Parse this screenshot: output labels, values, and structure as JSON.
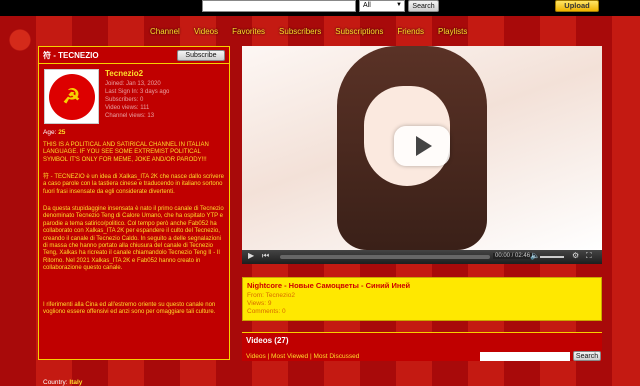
{
  "header": {
    "search_placeholder": "",
    "search_category": "All",
    "search_button": "Search",
    "upload_button": "Upload"
  },
  "nav": [
    "Channel",
    "Videos",
    "Favorites",
    "Subscribers",
    "Subscriptions",
    "Friends",
    "Playlists"
  ],
  "profile": {
    "title": "符 - TECNEZIO",
    "subscribe_label": "Subscribe",
    "username": "Tecnezio2",
    "info_lines": [
      "Joined: Jan 13, 2020",
      "Last Sign In: 3 days ago",
      "Subscribers: 0",
      "Video views: 111",
      "Channel views: 13"
    ],
    "age_label": "Age:",
    "age_value": "25",
    "paragraph_1": "THIS IS A POLITICAL AND SATIRICAL CHANNEL IN ITALIAN LANGUAGE. IF YOU SEE SOME EXTREMIST POLITICAL SYMBOL IT'S ONLY FOR MEME, JOKE AND/OR PARODY!!!",
    "paragraph_2": "符 - TECNEZIO è un idea di Xalkas_ITA 2K che nasce dallo scrivere a caso parole con la tastiera cinese e traducendo in italiano sortono fuori frasi insensate da egli considerate divertenti.",
    "paragraph_3": "Da questa stupidaggine insensata è nato il primo canale di Tecnezio denominato Tecnezio Teng di Calore Umano, che ha ospitato YTP e parodie a tema satirico/politico. Col tempo però anche Fab052 ha collaborato con Xalkas_ITA 2K per espandere il culto del Tecnezio, creando il canale di Tecnezio Caldo. In seguito a delle segnalazioni di massa che hanno portato alla chiusura del canale di Tecnezio Teng, Xalkas ha ricreato il canale chiamandolo Tecnezio Teng II - Il Ritorno. Nel 2021 Xalkas_ITA 2K e Fab052 hanno creato in collaborazione questo canale.",
    "paragraph_4": "I riferimenti alla Cina ed all'estremo oriente su questo canale non vogliono essere offensivi ed anzi sono per omaggiare tali culture.",
    "country_label": "Country:",
    "country_value": "Italy"
  },
  "player": {
    "time": "00:00 / 02:46"
  },
  "video": {
    "title": "Nightcore - Новые Самоцветы - Синий Иней",
    "from": "From: Tecnezio2",
    "views": "Views: 9",
    "comments": "Comments: 0"
  },
  "videos_section": {
    "title": "Videos (27)",
    "tabs": "Videos | Most Viewed | Most Discussed",
    "search_button": "Search"
  },
  "colors": {
    "accent_yellow": "#ffde2b",
    "panel_red": "#c00000",
    "info_yellow": "#ffe800"
  }
}
